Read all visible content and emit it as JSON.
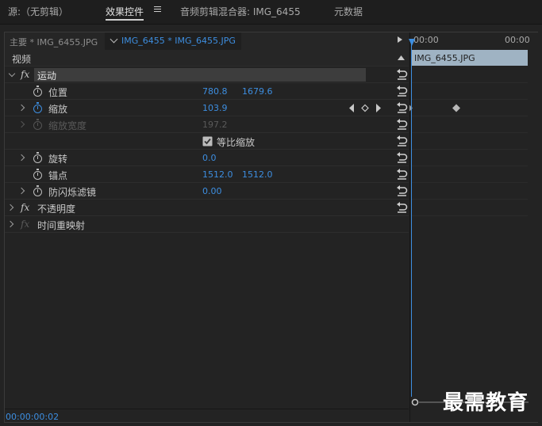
{
  "tabs": [
    {
      "label": "源:（无剪辑）",
      "active": false
    },
    {
      "label": "效果控件",
      "active": true
    },
    {
      "label": "音频剪辑混合器: IMG_6455",
      "active": false
    },
    {
      "label": "元数据",
      "active": false
    }
  ],
  "source_bar": {
    "master_label": "主要 * IMG_6455.JPG",
    "clip_label": "IMG_6455 * IMG_6455.JPG"
  },
  "section": {
    "label": "视频"
  },
  "effects": {
    "motion": {
      "label": "运动",
      "fx": "fx"
    },
    "position": {
      "label": "位置",
      "x": "780.8",
      "y": "1679.6"
    },
    "scale": {
      "label": "缩放",
      "value": "103.9"
    },
    "scale_width": {
      "label": "缩放宽度",
      "value": "197.2"
    },
    "uniform_scale": {
      "label": "等比缩放",
      "checked": true
    },
    "rotation": {
      "label": "旋转",
      "value": "0.0"
    },
    "anchor": {
      "label": "锚点",
      "x": "1512.0",
      "y": "1512.0"
    },
    "anti_flicker": {
      "label": "防闪烁滤镜",
      "value": "0.00"
    },
    "opacity": {
      "label": "不透明度",
      "fx": "fx"
    },
    "time_remap": {
      "label": "时间重映射",
      "fx": "fx"
    }
  },
  "timeline": {
    "tick_start": "00:00",
    "tick_end": "00:00",
    "clip_label": "IMG_6455.JPG"
  },
  "timecode": "00:00:00:02",
  "watermark": "最需教育",
  "colors": {
    "accent": "#3d8ee0",
    "clip": "#9fb3c3",
    "panel": "#232323"
  }
}
